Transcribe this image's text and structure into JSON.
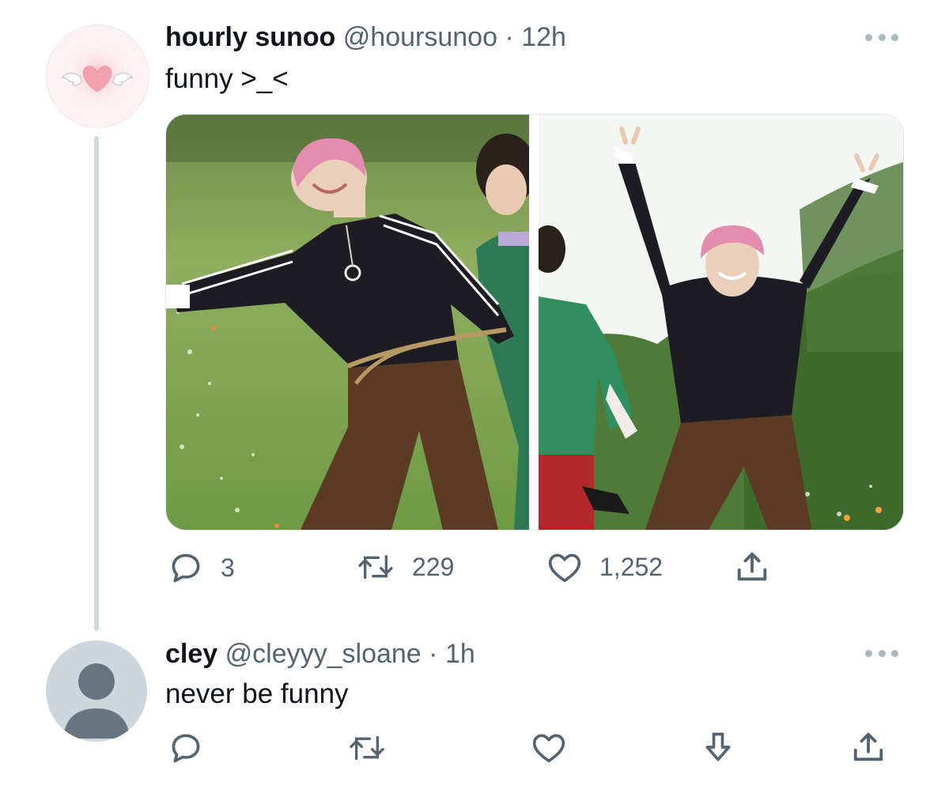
{
  "tweet1": {
    "display_name": "hourly sunoo",
    "handle": "@hoursunoo",
    "separator": "·",
    "time": "12h",
    "text": "funny >_<",
    "avatar_icon": "winged-heart-icon",
    "actions": {
      "reply_count": "3",
      "retweet_count": "229",
      "like_count": "1,252"
    },
    "media": [
      {
        "description_icon": "photo-person-pink-hair-rope"
      },
      {
        "description_icon": "photo-person-jumping"
      }
    ]
  },
  "tweet2": {
    "display_name": "cley",
    "handle": "@cleyyy_sloane",
    "separator": "·",
    "time": "1h",
    "text": "never be funny",
    "avatar_icon": "default-avatar-icon"
  },
  "colors": {
    "text_primary": "#0f1419",
    "text_secondary": "#536471",
    "thread_line": "#cfd9de",
    "icon_gray": "#536471"
  }
}
